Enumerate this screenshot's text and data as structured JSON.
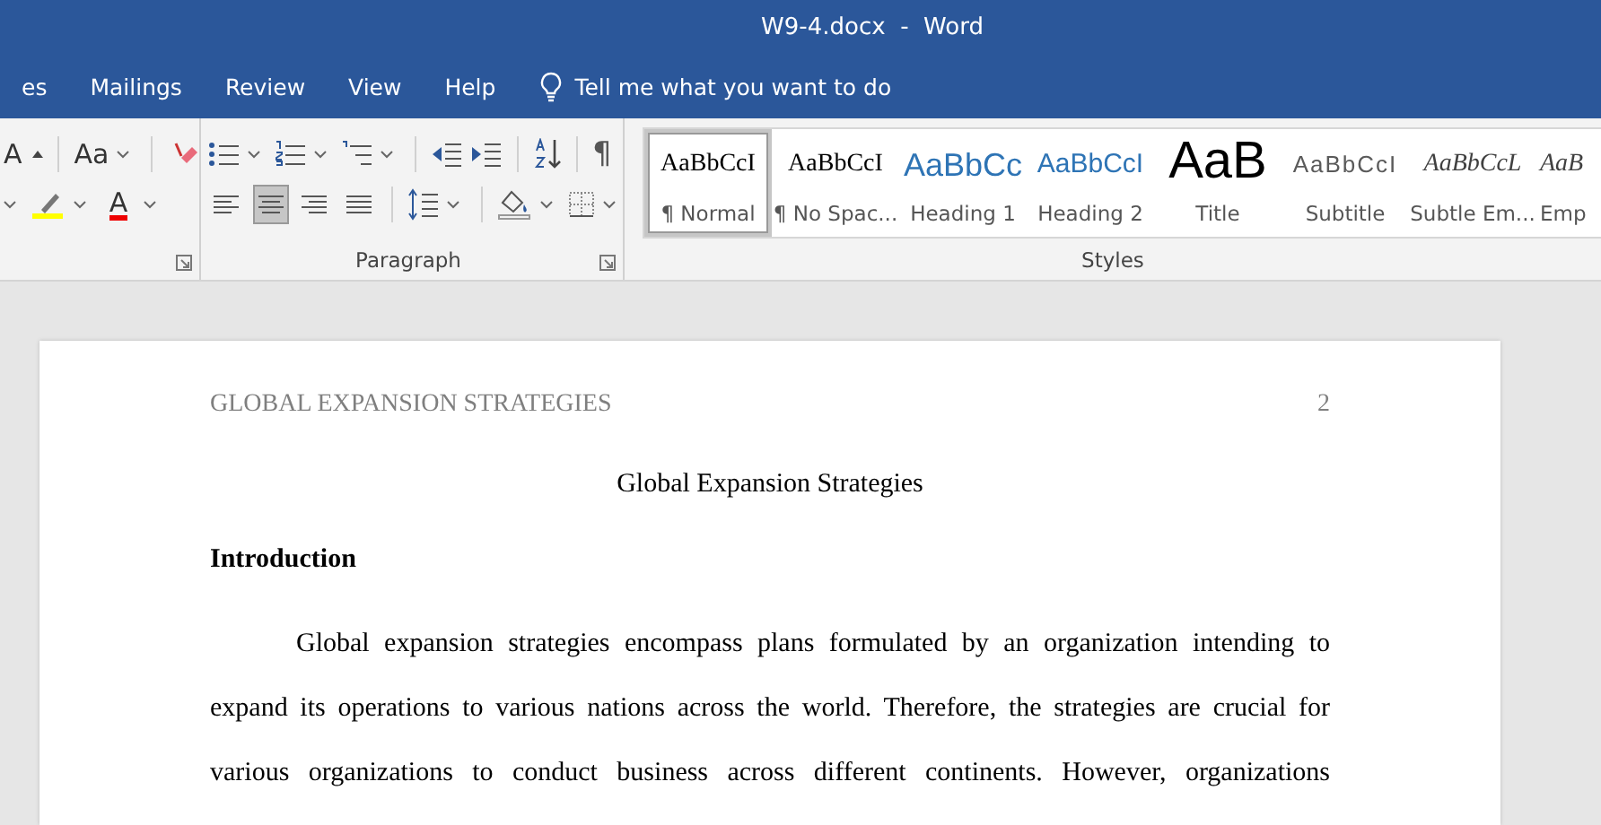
{
  "window": {
    "title": "W9-4.docx  -  Word"
  },
  "tabs": [
    {
      "label": "es",
      "selected": false
    },
    {
      "label": "Mailings",
      "selected": false
    },
    {
      "label": "Review",
      "selected": false
    },
    {
      "label": "View",
      "selected": false
    },
    {
      "label": "Help",
      "selected": false
    }
  ],
  "tell_me": {
    "placeholder": "Tell me what you want to do"
  },
  "font_group": {
    "grow_font": "A",
    "change_case": "Aa",
    "font_color": "A"
  },
  "paragraph_group": {
    "label": "Paragraph",
    "pilcrow": "¶",
    "alignments": [
      {
        "kind": "left",
        "selected": false
      },
      {
        "kind": "center",
        "selected": true
      },
      {
        "kind": "right",
        "selected": false
      },
      {
        "kind": "justify",
        "selected": false
      }
    ]
  },
  "styles_group": {
    "label": "Styles",
    "items": [
      {
        "kind": "normal",
        "preview": "AaBbCcI",
        "label": "¶ Normal",
        "selected": true
      },
      {
        "kind": "nospacing",
        "preview": "AaBbCcI",
        "label": "¶ No Spac...",
        "selected": false
      },
      {
        "kind": "heading1",
        "preview": "AaBbCc",
        "label": "Heading 1",
        "selected": false
      },
      {
        "kind": "heading2",
        "preview": "AaBbCcI",
        "label": "Heading 2",
        "selected": false
      },
      {
        "kind": "title",
        "preview": "AaB",
        "label": "Title",
        "selected": false
      },
      {
        "kind": "subtitle",
        "preview": "AaBbCcI",
        "label": "Subtitle",
        "selected": false
      },
      {
        "kind": "subtle",
        "preview": "AaBbCcL",
        "label": "Subtle Em...",
        "selected": false
      },
      {
        "kind": "emphasis",
        "preview": "AaB",
        "label": "Emp",
        "selected": false
      }
    ]
  },
  "document": {
    "header": "GLOBAL EXPANSION STRATEGIES",
    "page_number": "2",
    "title": "Global Expansion Strategies",
    "heading": "Introduction",
    "paragraph": "Global expansion strategies encompass plans formulated by an organization intending to expand its operations to various nations across the world. Therefore, the strategies are crucial for various organizations to conduct business across different continents. However, organizations"
  }
}
